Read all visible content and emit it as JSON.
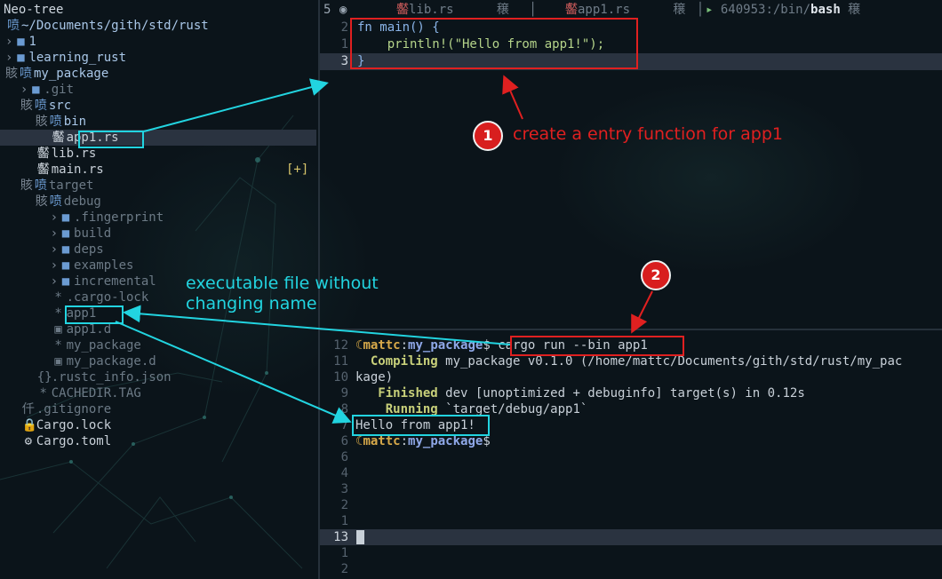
{
  "neotree": {
    "title": "Neo-tree",
    "rows": [
      {
        "prefix": "",
        "chev": "",
        "icon": "喷",
        "label": "~/Documents/gith/std/rust",
        "kind": "root"
      },
      {
        "prefix": "",
        "chev": "›",
        "icon": "■",
        "label": "1",
        "kind": "dir"
      },
      {
        "prefix": "",
        "chev": "›",
        "icon": "■",
        "label": "learning_rust",
        "kind": "dir"
      },
      {
        "prefix": "",
        "chev": "賅",
        "icon": "喷",
        "label": "my_package",
        "kind": "dir"
      },
      {
        "prefix": "  ",
        "chev": "›",
        "icon": "■",
        "label": ".git",
        "kind": "dimdir"
      },
      {
        "prefix": "  ",
        "chev": "賅",
        "icon": "喷",
        "label": "src",
        "kind": "dir"
      },
      {
        "prefix": "    ",
        "chev": "賅",
        "icon": "喷",
        "label": "bin",
        "kind": "dir"
      },
      {
        "prefix": "      ",
        "chev": "",
        "icon": "齾",
        "label": "app1.rs",
        "kind": "file"
      },
      {
        "prefix": "    ",
        "chev": "",
        "icon": "齾",
        "label": "lib.rs",
        "kind": "file"
      },
      {
        "prefix": "    ",
        "chev": "",
        "icon": "齾",
        "label": "main.rs",
        "kind": "file"
      },
      {
        "prefix": "  ",
        "chev": "賅",
        "icon": "喷",
        "label": "target",
        "kind": "dimdir"
      },
      {
        "prefix": "    ",
        "chev": "賅",
        "icon": "喷",
        "label": "debug",
        "kind": "dimdir"
      },
      {
        "prefix": "      ",
        "chev": "›",
        "icon": "■",
        "label": ".fingerprint",
        "kind": "dimdir"
      },
      {
        "prefix": "      ",
        "chev": "›",
        "icon": "■",
        "label": "build",
        "kind": "dimdir"
      },
      {
        "prefix": "      ",
        "chev": "›",
        "icon": "■",
        "label": "deps",
        "kind": "dimdir"
      },
      {
        "prefix": "      ",
        "chev": "›",
        "icon": "■",
        "label": "examples",
        "kind": "dimdir"
      },
      {
        "prefix": "      ",
        "chev": "›",
        "icon": "■",
        "label": "incremental",
        "kind": "dimdir"
      },
      {
        "prefix": "      ",
        "chev": "",
        "icon": "*",
        "label": ".cargo-lock",
        "kind": "dim"
      },
      {
        "prefix": "      ",
        "chev": "",
        "icon": "*",
        "label": "app1",
        "kind": "dim"
      },
      {
        "prefix": "      ",
        "chev": "",
        "icon": "▣",
        "label": "app1.d",
        "kind": "dim"
      },
      {
        "prefix": "      ",
        "chev": "",
        "icon": "*",
        "label": "my_package",
        "kind": "dim"
      },
      {
        "prefix": "      ",
        "chev": "",
        "icon": "▣",
        "label": "my_package.d",
        "kind": "dim"
      },
      {
        "prefix": "    ",
        "chev": "",
        "icon": "{}",
        "label": ".rustc_info.json",
        "kind": "dim"
      },
      {
        "prefix": "    ",
        "chev": "",
        "icon": "*",
        "label": "CACHEDIR.TAG",
        "kind": "dim"
      },
      {
        "prefix": "  ",
        "chev": "",
        "icon": "仟",
        "label": ".gitignore",
        "kind": "dim"
      },
      {
        "prefix": "  ",
        "chev": "",
        "icon": "🔒",
        "label": "Cargo.lock",
        "kind": "file"
      },
      {
        "prefix": "  ",
        "chev": "",
        "icon": "⚙",
        "label": "Cargo.toml",
        "kind": "file"
      }
    ],
    "git_status": "[+]"
  },
  "tabbar": {
    "buffer_count": "5",
    "nav_icon": "◉",
    "tabs": [
      {
        "icon": "齾",
        "name": "lib.rs",
        "close": "穣"
      },
      {
        "icon": "齾",
        "name": "app1.rs",
        "close": "穣"
      },
      {
        "icon": "▸",
        "name": "640953:/bin/",
        "bold": "bash",
        "close": "穣"
      }
    ]
  },
  "editor": {
    "lines": [
      {
        "num": "2",
        "code": "fn main() {"
      },
      {
        "num": "1",
        "code": "    println!(\"Hello from app1!\");"
      },
      {
        "num": "3",
        "code": "}"
      }
    ]
  },
  "terminal": {
    "prompt_user": "mattc",
    "prompt_sep": ":",
    "prompt_dir": "my_package",
    "prompt_end": "$",
    "command": "cargo run --bin app1",
    "lines": [
      {
        "num": "12",
        "kind": "prompt"
      },
      {
        "num": "11",
        "kind": "out",
        "label": "Compiling",
        "text": " my_package v0.1.0 (/home/mattc/Documents/gith/std/rust/my_pac"
      },
      {
        "num": "10",
        "kind": "wrap",
        "text": "kage)"
      },
      {
        "num": "9",
        "kind": "out2",
        "label": "Finished",
        "text": " dev [unoptimized + debuginfo] target(s) in 0.12s"
      },
      {
        "num": "8",
        "kind": "out3",
        "label": "Running",
        "text": " `target/debug/app1`"
      },
      {
        "num": "7",
        "kind": "plain",
        "text": "Hello from app1!"
      },
      {
        "num": "6",
        "kind": "prompt2"
      },
      {
        "num": "6",
        "kind": "empty"
      },
      {
        "num": "4",
        "kind": "empty"
      },
      {
        "num": "3",
        "kind": "empty"
      },
      {
        "num": "2",
        "kind": "empty"
      },
      {
        "num": "1",
        "kind": "empty"
      },
      {
        "num": "13",
        "kind": "cursor"
      },
      {
        "num": "1",
        "kind": "empty"
      },
      {
        "num": "2",
        "kind": "empty"
      }
    ]
  },
  "annotations": {
    "step1_num": "1",
    "step1_text": "create a entry function for app1",
    "step2_num": "2",
    "exec_note_line1": "executable file without",
    "exec_note_line2": "changing name"
  },
  "colors": {
    "red": "#e02020",
    "cyan": "#22d4e0",
    "background": "#0b141a"
  }
}
